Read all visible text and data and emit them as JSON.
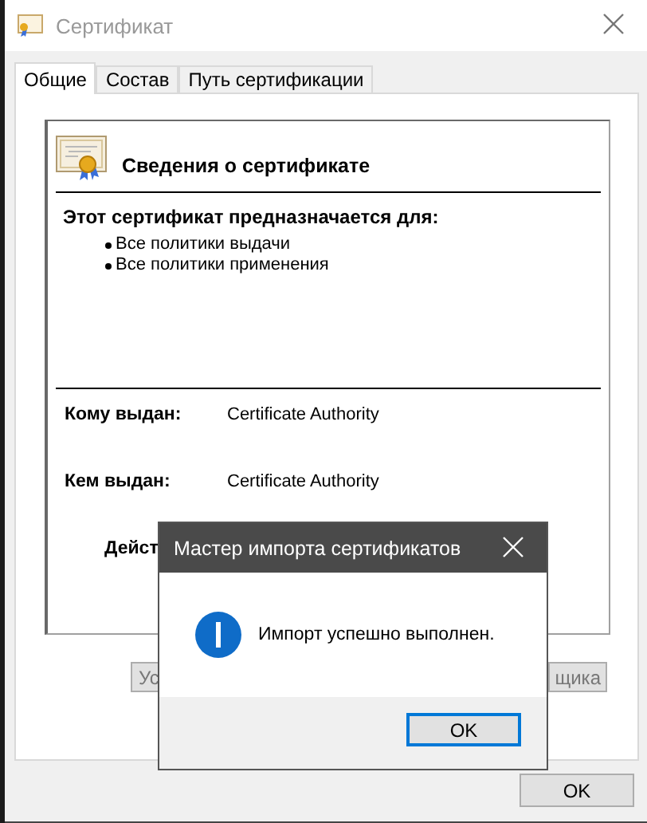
{
  "window": {
    "title": "Сертификат"
  },
  "tabs": [
    {
      "label": "Общие",
      "selected": true
    },
    {
      "label": "Состав",
      "selected": false
    },
    {
      "label": "Путь сертификации",
      "selected": false
    }
  ],
  "certificate": {
    "heading": "Сведения о сертификате",
    "purpose_title": "Этот сертификат предназначается для:",
    "purposes": [
      "Все политики выдачи",
      "Все политики применения"
    ],
    "fields": [
      {
        "label": "Кому выдан:",
        "value": "Certificate Authority"
      },
      {
        "label": "Кем выдан:",
        "value": "Certificate Authority"
      },
      {
        "label": "Дейст"
      }
    ]
  },
  "panel_buttons": [
    "Ус",
    "щика"
  ],
  "footer_buttons": [
    "OK"
  ],
  "dialog": {
    "title": "Мастер импорта сертификатов",
    "message": "Импорт успешно выполнен.",
    "buttons": [
      {
        "label": "OK",
        "focused": true
      }
    ]
  }
}
